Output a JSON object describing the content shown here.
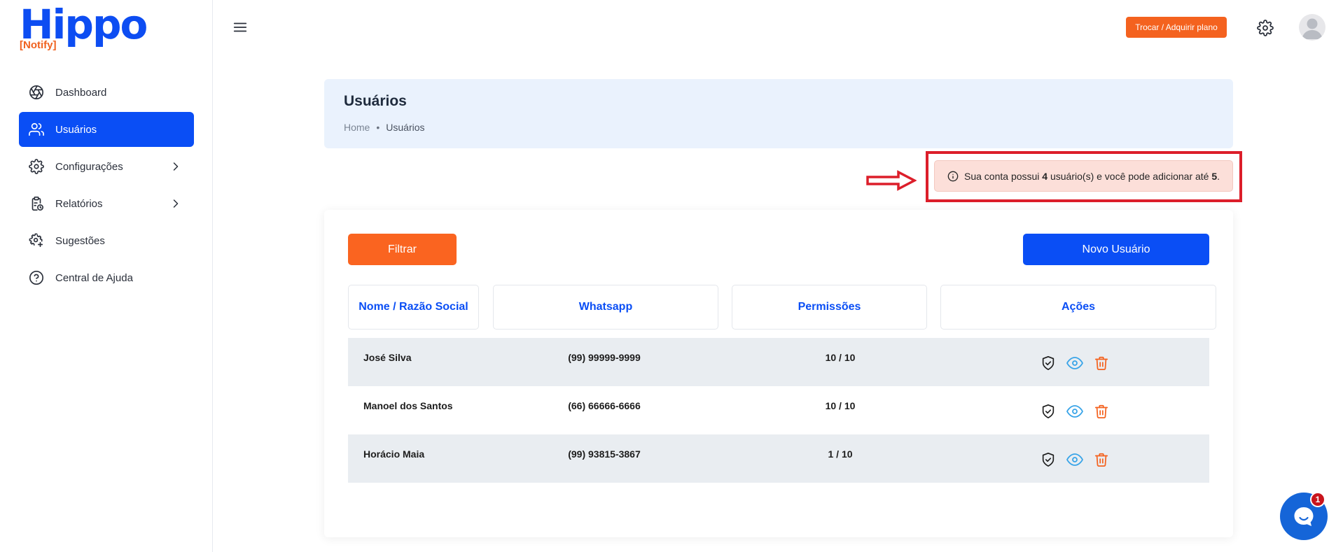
{
  "brand": {
    "name": "Hippo",
    "sub_open": "[",
    "sub": "Notify",
    "sub_close": "]"
  },
  "colors": {
    "primary": "#0a4ef5",
    "accent": "#fa6420",
    "danger": "#dc1e2a",
    "alert_bg": "#fcdfd9"
  },
  "sidebar": {
    "items": [
      {
        "label": "Dashboard",
        "icon": "aperture-icon",
        "active": false
      },
      {
        "label": "Usuários",
        "icon": "users-icon",
        "active": true
      },
      {
        "label": "Configurações",
        "icon": "gear-icon",
        "active": false,
        "has_submenu": true
      },
      {
        "label": "Relatórios",
        "icon": "clipboard-clock-icon",
        "active": false,
        "has_submenu": true
      },
      {
        "label": "Sugestões",
        "icon": "gear-plus-icon",
        "active": false
      },
      {
        "label": "Central de Ajuda",
        "icon": "help-circle-icon",
        "active": false
      }
    ]
  },
  "topbar": {
    "plan_label": "Trocar / Adquirir plano"
  },
  "header": {
    "title": "Usuários",
    "breadcrumb": {
      "home": "Home",
      "separator": "•",
      "current": "Usuários"
    }
  },
  "alert": {
    "text_before": "Sua conta possui ",
    "count": "4",
    "text_middle": " usuário(s) e você pode adicionar até ",
    "limit": "5",
    "text_after": "."
  },
  "toolbar": {
    "filter_label": "Filtrar",
    "new_user_label": "Novo Usuário"
  },
  "table": {
    "columns": [
      "Nome / Razão Social",
      "Whatsapp",
      "Permissões",
      "Ações"
    ],
    "rows": [
      {
        "name": "José Silva",
        "whatsapp": "(99) 99999-9999",
        "permissions": "10 / 10"
      },
      {
        "name": "Manoel dos Santos",
        "whatsapp": "(66) 66666-6666",
        "permissions": "10 / 10"
      },
      {
        "name": "Horácio Maia",
        "whatsapp": "(99) 93815-3867",
        "permissions": "1 / 10"
      }
    ]
  },
  "chat": {
    "badge_count": "1"
  }
}
